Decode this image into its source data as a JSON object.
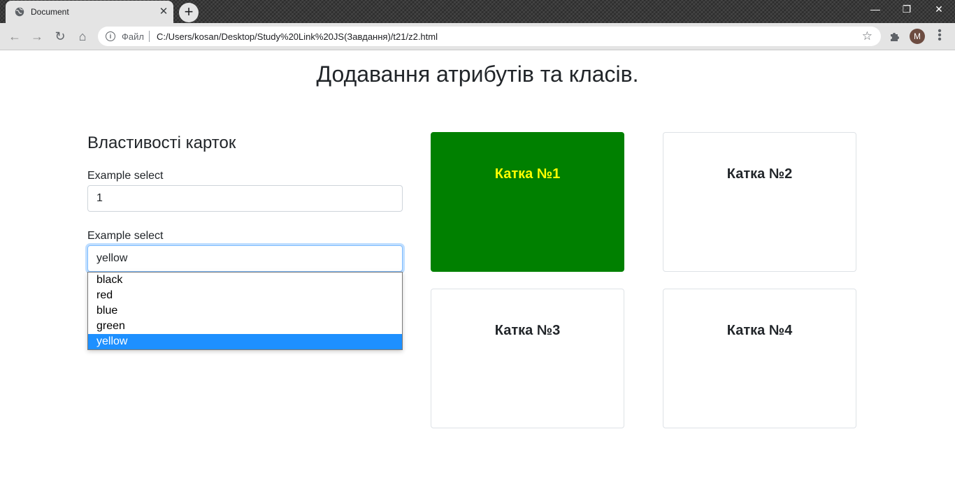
{
  "browser": {
    "tab_title": "Document",
    "tab_close": "✕",
    "new_tab": "+",
    "window_controls": {
      "minimize": "—",
      "restore": "❐",
      "close": "✕"
    },
    "nav": {
      "back": "←",
      "forward": "→",
      "reload": "↻",
      "home": "⌂"
    },
    "address": {
      "info": "i",
      "scheme": "Файл",
      "url": "C:/Users/kosan/Desktop/Study%20Link%20JS(Завдання)/t21/z2.html"
    },
    "star": "☆",
    "profile_initial": "M",
    "menu": "⋮"
  },
  "page": {
    "title": "Додавання атрибутів та класів."
  },
  "panel": {
    "heading": "Властивості карток",
    "select1": {
      "label": "Example select",
      "value": "1"
    },
    "select2": {
      "label": "Example select",
      "value": "yellow",
      "options": [
        "black",
        "red",
        "blue",
        "green",
        "yellow"
      ],
      "selected_index": 4
    }
  },
  "cards": [
    {
      "title": "Катка №1",
      "background": "#008000",
      "text_color": "#ffff00",
      "active": true
    },
    {
      "title": "Катка №2"
    },
    {
      "title": "Катка №3"
    },
    {
      "title": "Катка №4"
    }
  ]
}
